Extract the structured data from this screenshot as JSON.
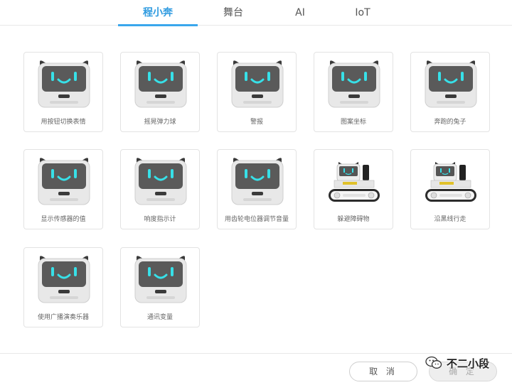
{
  "tabs": [
    {
      "label": "程小奔",
      "active": true
    },
    {
      "label": "舞台",
      "active": false
    },
    {
      "label": "AI",
      "active": false
    },
    {
      "label": "IoT",
      "active": false
    }
  ],
  "examples": [
    {
      "title": "用按钮切换表情",
      "thumb": "robot-face"
    },
    {
      "title": "摇晃弹力球",
      "thumb": "robot-face"
    },
    {
      "title": "警报",
      "thumb": "robot-face"
    },
    {
      "title": "图案坐标",
      "thumb": "robot-face"
    },
    {
      "title": "奔跑的兔子",
      "thumb": "robot-face"
    },
    {
      "title": "显示传感器的值",
      "thumb": "robot-face"
    },
    {
      "title": "响度指示计",
      "thumb": "robot-face"
    },
    {
      "title": "用齿轮电位器调节音量",
      "thumb": "robot-face"
    },
    {
      "title": "躲避障碍物",
      "thumb": "robot-car"
    },
    {
      "title": "沿黑线行走",
      "thumb": "robot-car"
    },
    {
      "title": "使用广播演奏乐器",
      "thumb": "robot-face"
    },
    {
      "title": "通讯变量",
      "thumb": "robot-face"
    }
  ],
  "footer": {
    "cancel_label": "取 消",
    "confirm_label": "确 定"
  },
  "watermark": {
    "text": "不二小段",
    "icon": "wechat-icon"
  },
  "colors": {
    "accent": "#3aa7ec",
    "face_screen": "#5a5a5a",
    "eyes": "#37e0e8"
  }
}
